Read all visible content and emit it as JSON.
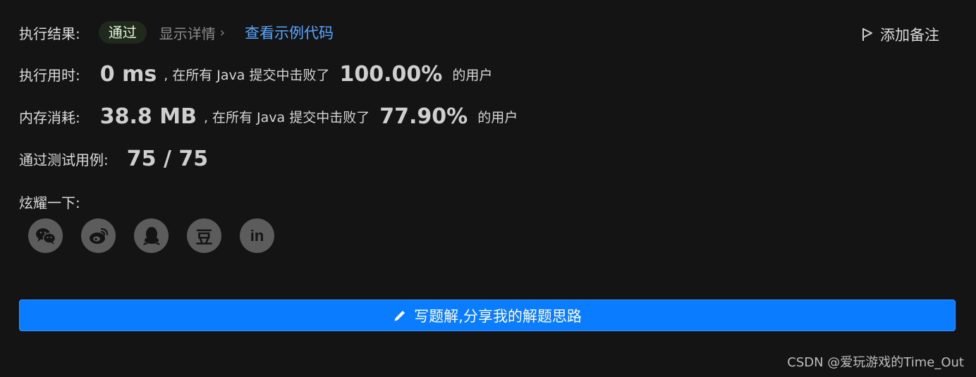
{
  "result": {
    "label": "执行结果:",
    "status": "通过",
    "details_link": "显示详情",
    "example_link": "查看示例代码",
    "add_note": "添加备注"
  },
  "runtime": {
    "label": "执行用时:",
    "value": "0 ms",
    "middle": ", 在所有 Java 提交中击败了",
    "percent": "100.00%",
    "suffix": "的用户"
  },
  "memory": {
    "label": "内存消耗:",
    "value": "38.8 MB",
    "middle": ", 在所有 Java 提交中击败了",
    "percent": "77.90%",
    "suffix": "的用户"
  },
  "tests": {
    "label": "通过测试用例:",
    "value": "75 / 75"
  },
  "share": {
    "label": "炫耀一下:",
    "icons": [
      "wechat-icon",
      "weibo-icon",
      "qq-icon",
      "douban-icon",
      "linkedin-icon"
    ],
    "douban_glyph": "豆",
    "linkedin_glyph": "in"
  },
  "cta": {
    "label": "写题解,分享我的解题思路"
  },
  "watermark": "CSDN @爱玩游戏的Time_Out",
  "colors": {
    "background": "#141414",
    "accent_blue": "#0a7cff",
    "link_blue": "#58a6ff",
    "pass_bg": "#1f2a1c"
  }
}
